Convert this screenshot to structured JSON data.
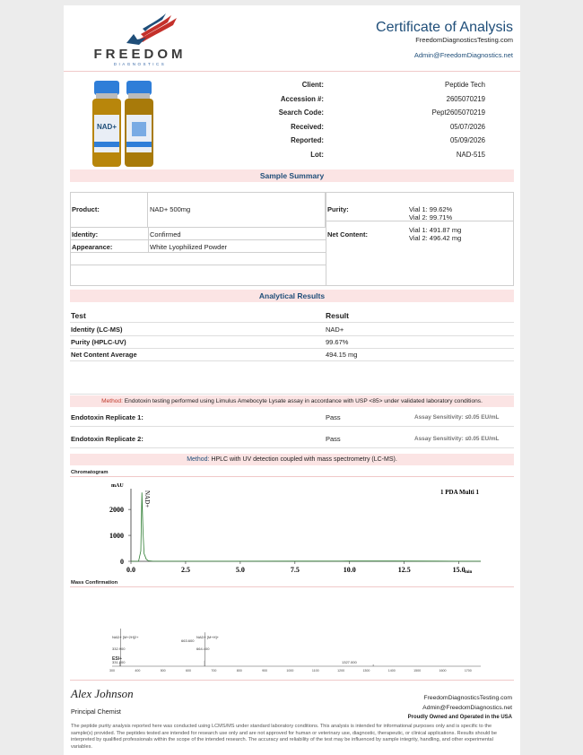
{
  "header": {
    "logo_word": "FREEDOM",
    "logo_sub": "DIAGNOSTICS",
    "title": "Certificate of Analysis",
    "website": "FreedomDiagnosticsTesting.com",
    "email": "Admin@FreedomDiagnostics.net"
  },
  "info": [
    {
      "label": "Client:",
      "value": "Peptide Tech"
    },
    {
      "label": "Accession #:",
      "value": "2605070219"
    },
    {
      "label": "Search Code:",
      "value": "Pept2605070219"
    },
    {
      "label": "Received:",
      "value": "05/07/2026"
    },
    {
      "label": "Reported:",
      "value": "05/09/2026"
    },
    {
      "label": "Lot:",
      "value": "NAD-515"
    }
  ],
  "vial_label": "NAD+",
  "sample_summary": {
    "title": "Sample Summary",
    "product_label": "Product:",
    "product_value": "NAD+ 500mg",
    "identity_label": "Identity:",
    "identity_value": "Confirmed",
    "appearance_label": "Appearance:",
    "appearance_value": "White Lyophilized Powder",
    "purity_label": "Purity:",
    "purity_v1": "Vial 1: 99.62%",
    "purity_v2": "Vial 2: 99.71%",
    "net_label": "Net Content:",
    "net_v1": "Vial 1: 491.87 mg",
    "net_v2": "Vial 2: 496.42 mg"
  },
  "analytical": {
    "title": "Analytical Results",
    "col_test": "Test",
    "col_result": "Result",
    "rows": [
      {
        "test": "Identity (LC-MS)",
        "result": "NAD+"
      },
      {
        "test": "Purity (HPLC-UV)",
        "result": "99.67%"
      },
      {
        "test": "Net Content Average",
        "result": "494.15 mg"
      }
    ]
  },
  "endotoxin": {
    "method_key": "Method:",
    "method_text": "Endotoxin testing performed using Limulus Amebocyte Lysate assay in accordance with USP <85> under validated laboratory conditions.",
    "rows": [
      {
        "test": "Endotoxin Replicate 1:",
        "result": "Pass",
        "sensitivity": "Assay Sensitivity: ≤0.05 EU/mL"
      },
      {
        "test": "Endotoxin Replicate 2:",
        "result": "Pass",
        "sensitivity": "Assay Sensitivity: ≤0.05 EU/mL"
      }
    ]
  },
  "hplc_method": {
    "key": "Method:",
    "text": "HPLC with UV detection coupled with mass spectrometry (LC-MS)."
  },
  "chromatogram": {
    "label": "Chromatogram",
    "unit_y": "mAU",
    "unit_x": "min",
    "legend": "1 PDA Multi 1",
    "peak_label": "NAD+"
  },
  "mass": {
    "label": "Mass Confirmation",
    "ann_1": "NAD+ [M+2H]2+",
    "ann_2": "332.900",
    "ann_3": "663.600",
    "ann_4": "NAD+ [M+H]+",
    "ann_5": "664.400",
    "ann_6": "1327.000",
    "ann_7": "ESI+",
    "ann_8": "331.200"
  },
  "footer": {
    "signature": "Alex Johnson",
    "signer": "Principal Chemist",
    "website": "FreedomDiagnosticsTesting.com",
    "email": "Admin@FreedomDiagnostics.net",
    "tagline": "Proudly Owned and Operated in the USA",
    "disclaimer": "The peptide purity analysis reported here was conducted using LCMS/MS under standard laboratory conditions. This analysis is intended for informational purposes only and is specific to the sample(s) provided. The peptides tested are intended for research use only and are not approved for human or veterinary use, diagnostic, therapeutic, or clinical applications. Results should be interpreted by qualified professionals within the scope of the intended research. The accuracy and reliability of the test may be influenced by sample integrity, handling, and other experimental variables."
  },
  "chart_data": [
    {
      "type": "line",
      "title": "",
      "ylabel": "mAU",
      "xlabel": "min",
      "x_ticks": [
        "0.0",
        "2.5",
        "5.0",
        "7.5",
        "10.0",
        "12.5",
        "15.0"
      ],
      "y_ticks": [
        "0",
        "1000",
        "2000"
      ],
      "xlim": [
        0,
        16
      ],
      "ylim": [
        0,
        2800
      ],
      "series": [
        {
          "name": "1 PDA Multi 1",
          "x": [
            0,
            0.35,
            0.45,
            0.5,
            0.55,
            0.6,
            0.7,
            0.8,
            1.0,
            2,
            4,
            8,
            10,
            12,
            14,
            16
          ],
          "y": [
            0,
            5,
            400,
            2650,
            1200,
            300,
            80,
            20,
            5,
            3,
            5,
            8,
            12,
            10,
            6,
            3
          ]
        }
      ],
      "annotations": [
        "NAD+"
      ]
    },
    {
      "type": "bar",
      "title": "",
      "xlabel": "m/z",
      "x_ticks": [
        "300",
        "400",
        "500",
        "600",
        "700",
        "800",
        "900",
        "1000",
        "1100",
        "1200",
        "1300",
        "1400",
        "1500",
        "1600",
        "1700"
      ],
      "xlim": [
        300,
        1750
      ],
      "peaks": [
        {
          "mz": 331.2,
          "intensity": 0.12
        },
        {
          "mz": 332.9,
          "intensity": 1.0
        },
        {
          "mz": 663.6,
          "intensity": 0.15
        },
        {
          "mz": 664.4,
          "intensity": 0.9
        },
        {
          "mz": 1327.0,
          "intensity": 0.05
        }
      ]
    }
  ]
}
